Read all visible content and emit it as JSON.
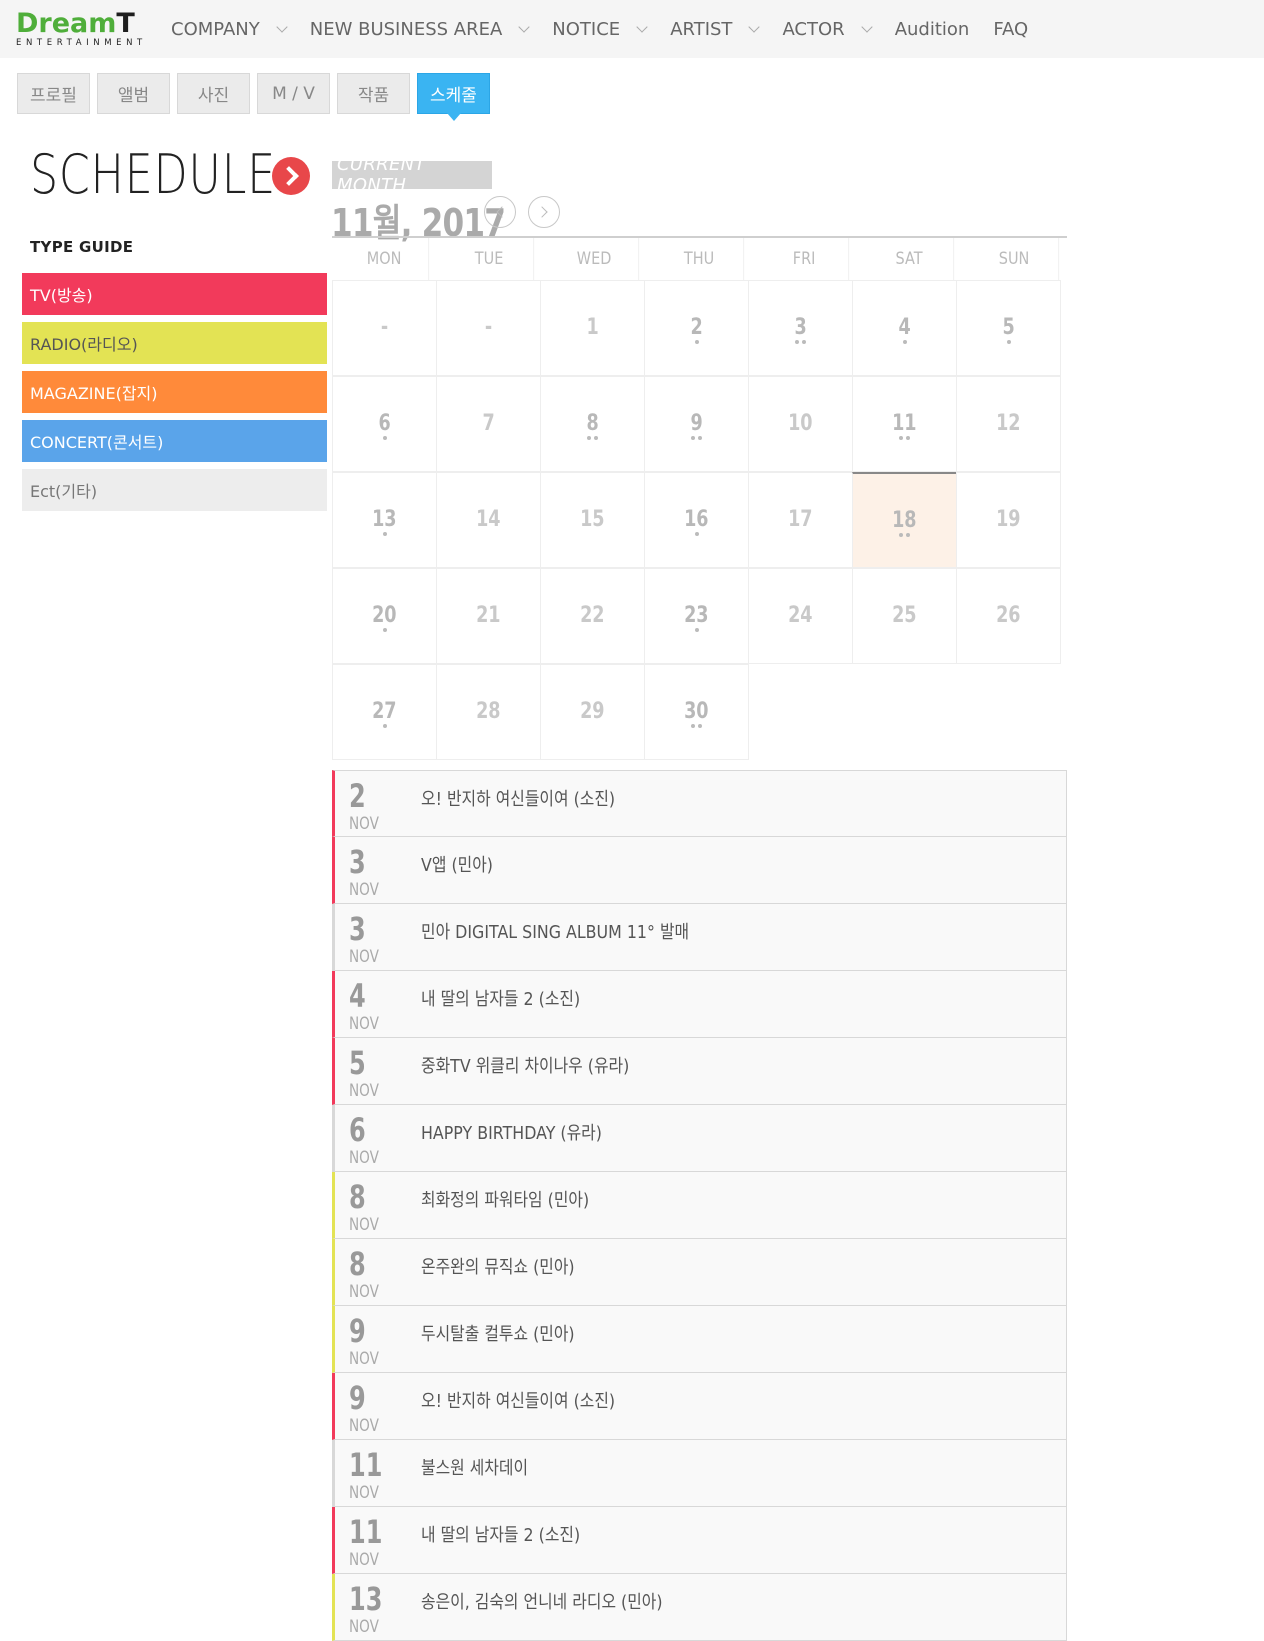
{
  "header": {
    "logo": {
      "word_a": "Dream",
      "word_b": "T",
      "sub": "ENTERTAINMENT"
    },
    "nav": [
      {
        "label": "COMPANY",
        "has_menu": true
      },
      {
        "label": "NEW BUSINESS AREA",
        "has_menu": true
      },
      {
        "label": "NOTICE",
        "has_menu": true
      },
      {
        "label": "ARTIST",
        "has_menu": true
      },
      {
        "label": "ACTOR",
        "has_menu": true
      },
      {
        "label": "Audition",
        "has_menu": false
      },
      {
        "label": "FAQ",
        "has_menu": false
      }
    ]
  },
  "tabs": [
    {
      "label": "프로필",
      "active": false
    },
    {
      "label": "앨범",
      "active": false
    },
    {
      "label": "사진",
      "active": false
    },
    {
      "label": "M / V",
      "active": false
    },
    {
      "label": "작품",
      "active": false
    },
    {
      "label": "스케줄",
      "active": true
    }
  ],
  "schedule": {
    "title": "SCHEDULE",
    "type_guide_label": "TYPE GUIDE",
    "types": [
      {
        "label": "TV(방송)",
        "color": "#f23a5b",
        "text_color": "#ffffff"
      },
      {
        "label": "RADIO(라디오)",
        "color": "#e3e354",
        "text_color": "#555555"
      },
      {
        "label": "MAGAZINE(잡지)",
        "color": "#ff8a3a",
        "text_color": "#ffffff"
      },
      {
        "label": "CONCERT(콘서트)",
        "color": "#5aa4ea",
        "text_color": "#ffffff"
      },
      {
        "label": "Ect(기타)",
        "color": "#ededed",
        "text_color": "#777777"
      }
    ]
  },
  "calendar": {
    "current_month_label": "CURRENT MONTH",
    "month_label": "11월, 2017",
    "weekdays": [
      "MON",
      "TUE",
      "WED",
      "THU",
      "FRI",
      "SAT",
      "SUN"
    ],
    "today": "18",
    "weeks": [
      [
        {
          "d": "-",
          "dots": 0
        },
        {
          "d": "-",
          "dots": 0
        },
        {
          "d": "1",
          "dots": 0
        },
        {
          "d": "2",
          "dots": 1
        },
        {
          "d": "3",
          "dots": 2
        },
        {
          "d": "4",
          "dots": 1
        },
        {
          "d": "5",
          "dots": 1
        }
      ],
      [
        {
          "d": "6",
          "dots": 1
        },
        {
          "d": "7",
          "dots": 0
        },
        {
          "d": "8",
          "dots": 2
        },
        {
          "d": "9",
          "dots": 2
        },
        {
          "d": "10",
          "dots": 0
        },
        {
          "d": "11",
          "dots": 2
        },
        {
          "d": "12",
          "dots": 0
        }
      ],
      [
        {
          "d": "13",
          "dots": 1
        },
        {
          "d": "14",
          "dots": 0
        },
        {
          "d": "15",
          "dots": 0
        },
        {
          "d": "16",
          "dots": 1
        },
        {
          "d": "17",
          "dots": 0
        },
        {
          "d": "18",
          "dots": 2
        },
        {
          "d": "19",
          "dots": 0
        }
      ],
      [
        {
          "d": "20",
          "dots": 1
        },
        {
          "d": "21",
          "dots": 0
        },
        {
          "d": "22",
          "dots": 0
        },
        {
          "d": "23",
          "dots": 1
        },
        {
          "d": "24",
          "dots": 0
        },
        {
          "d": "25",
          "dots": 0
        },
        {
          "d": "26",
          "dots": 0
        }
      ],
      [
        {
          "d": "27",
          "dots": 1
        },
        {
          "d": "28",
          "dots": 0
        },
        {
          "d": "29",
          "dots": 0
        },
        {
          "d": "30",
          "dots": 2
        },
        null,
        null,
        null
      ]
    ]
  },
  "events": [
    {
      "day": "2",
      "month": "NOV",
      "title": "오! 반지하 여신들이여 (소진)",
      "color": "#f23a5b"
    },
    {
      "day": "3",
      "month": "NOV",
      "title": "V앱 (민아)",
      "color": "#f23a5b"
    },
    {
      "day": "3",
      "month": "NOV",
      "title": "민아 DIGITAL SING ALBUM 11° 발매",
      "color": "#d8d8d8"
    },
    {
      "day": "4",
      "month": "NOV",
      "title": "내 딸의 남자들 2 (소진)",
      "color": "#f23a5b"
    },
    {
      "day": "5",
      "month": "NOV",
      "title": "중화TV 위클리 차이나우 (유라)",
      "color": "#f23a5b"
    },
    {
      "day": "6",
      "month": "NOV",
      "title": "HAPPY BIRTHDAY (유라)",
      "color": "#d8d8d8"
    },
    {
      "day": "8",
      "month": "NOV",
      "title": "최화정의 파워타임 (민아)",
      "color": "#e3e354"
    },
    {
      "day": "8",
      "month": "NOV",
      "title": "온주완의 뮤직쇼 (민아)",
      "color": "#e3e354"
    },
    {
      "day": "9",
      "month": "NOV",
      "title": "두시탈출 컬투쇼 (민아)",
      "color": "#e3e354"
    },
    {
      "day": "9",
      "month": "NOV",
      "title": "오! 반지하 여신들이여 (소진)",
      "color": "#f23a5b"
    },
    {
      "day": "11",
      "month": "NOV",
      "title": "불스원 세차데이",
      "color": "#d8d8d8"
    },
    {
      "day": "11",
      "month": "NOV",
      "title": "내 딸의 남자들 2 (소진)",
      "color": "#f23a5b"
    },
    {
      "day": "13",
      "month": "NOV",
      "title": "송은이, 김숙의 언니네 라디오 (민아)",
      "color": "#e3e354"
    }
  ]
}
